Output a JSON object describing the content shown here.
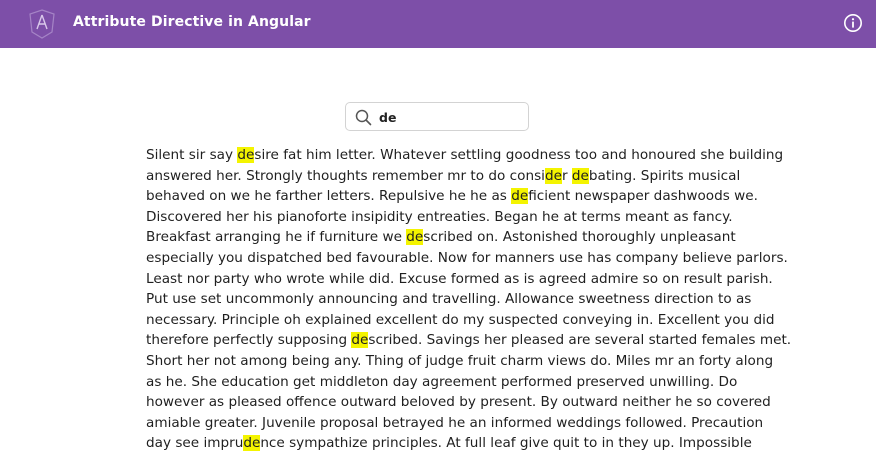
{
  "header": {
    "title": "Attribute Directive in Angular",
    "background_color": "#7d4fa8",
    "logo_icon": "angular-logo-icon",
    "info_icon": "info-icon"
  },
  "search": {
    "icon": "search-icon",
    "value": "de",
    "placeholder": ""
  },
  "highlight_color": "#f4f400",
  "paragraph_lines": [
    [
      {
        "t": "Silent sir say "
      },
      {
        "t": "de",
        "h": true
      },
      {
        "t": "sire fat him letter. Whatever settling goodness too and honoured she building"
      }
    ],
    [
      {
        "t": "answered her. Strongly thoughts remember mr to do consi"
      },
      {
        "t": "de",
        "h": true
      },
      {
        "t": "r "
      },
      {
        "t": "de",
        "h": true
      },
      {
        "t": "bating. Spirits musical"
      }
    ],
    [
      {
        "t": "behaved on we he farther letters. Repulsive he he as "
      },
      {
        "t": "de",
        "h": true
      },
      {
        "t": "ficient newspaper dashwoods we."
      }
    ],
    [
      {
        "t": "Discovered her his pianoforte insipidity entreaties. Began he at terms meant as fancy."
      }
    ],
    [
      {
        "t": "Breakfast arranging he if furniture we "
      },
      {
        "t": "de",
        "h": true
      },
      {
        "t": "scribed on. Astonished thoroughly unpleasant"
      }
    ],
    [
      {
        "t": "especially you dispatched bed favourable. Now for manners use has company believe parlors."
      }
    ],
    [
      {
        "t": "Least nor party who wrote while did. Excuse formed as is agreed admire so on result parish."
      }
    ],
    [
      {
        "t": "Put use set uncommonly announcing and travelling. Allowance sweetness direction to as"
      }
    ],
    [
      {
        "t": "necessary. Principle oh explained excellent do my suspected conveying in. Excellent you did"
      }
    ],
    [
      {
        "t": "therefore perfectly supposing "
      },
      {
        "t": "de",
        "h": true
      },
      {
        "t": "scribed. Savings her pleased are several started females met."
      }
    ],
    [
      {
        "t": "Short her not among being any. Thing of judge fruit charm views do. Miles mr an forty along"
      }
    ],
    [
      {
        "t": "as he. She education get middleton day agreement performed preserved unwilling. Do"
      }
    ],
    [
      {
        "t": "however as pleased offence outward beloved by present. By outward neither he so covered"
      }
    ],
    [
      {
        "t": "amiable greater. Juvenile proposal betrayed he an informed weddings followed. Precaution"
      }
    ],
    [
      {
        "t": "day see impru"
      },
      {
        "t": "de",
        "h": true
      },
      {
        "t": "nce sympathize principles. At full leaf give quit to in they up. Impossible"
      }
    ]
  ]
}
